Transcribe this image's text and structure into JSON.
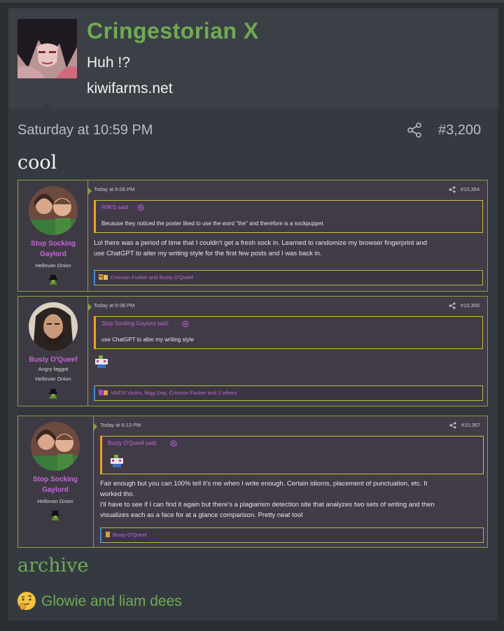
{
  "post": {
    "username": "Cringestorian X",
    "user_title": "Huh !?",
    "user_site": "kiwifarms.net",
    "date": "Saturday at 10:59 PM",
    "number": "#3,200",
    "text": "cool",
    "archive_link": "archive",
    "reactions_text": "Glowie and liam dees",
    "reaction_icon": "thinking-face-icon"
  },
  "embedded_thread": [
    {
      "username_line1": "Stop Socking",
      "username_line2": "Gaylord",
      "user_title": "",
      "rank": "Hellovan Onion",
      "date": "Today at 6:06 PM",
      "number": "#10,354",
      "quote_author": "R9KS said:",
      "quote_text": "Because they noticed the poster liked to use the word \"the\" and therefore is a sockpuppet.",
      "body_line1": "Lol there was a period of time that I couldn't get a fresh sock in. Learned to randomize my browser fingerprint and",
      "body_line2": "use ChatGPT to alter my writing style for the first few posts and I was back in.",
      "body_line3": "",
      "body_line4": "",
      "reactions": "Crimson Fucker and Busty O'Queef"
    },
    {
      "username_line1": "Busty O'Queef",
      "username_line2": "",
      "user_title": "Angry faggot",
      "rank": "Hellovan Onion",
      "date": "Today at 6:08 PM",
      "number": "#10,355",
      "quote_author": "Stop Socking Gaylord said:",
      "quote_text": "use ChatGPT to alter my writing style",
      "body_line1": "",
      "body_line2": "",
      "body_line3": "",
      "body_line4": "",
      "reactions": "VAIDS Victim, Bigg Drip, Crimson Fucker and 2 others"
    },
    {
      "username_line1": "Stop Socking",
      "username_line2": "Gaylord",
      "user_title": "",
      "rank": "Hellovan Onion",
      "date": "Today at 6:13 PM",
      "number": "#10,357",
      "quote_author": "Busty O'Queef said:",
      "quote_text": "",
      "body_line1": "Fair enough but you can 100% tell it's me when I write enough. Certain idioms, placement of punctuation, etc. It",
      "body_line2": "worked tho.",
      "body_line3": "I'll have to see if I can find it again but there's a plagiarism detection site that analyzes two sets of writing and then",
      "body_line4": "visualizes each as a face for at a glance comparison. Pretty neat tool",
      "reactions": "Busty O'Queef"
    }
  ],
  "colors": {
    "accent_green": "#6fab53",
    "username_purple": "#c667d9",
    "quote_border": "#cdbf3a"
  }
}
